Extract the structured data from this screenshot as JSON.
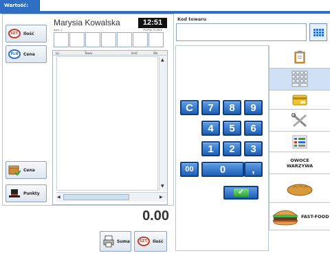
{
  "header": {
    "value_tab": "Wartość: 0.00"
  },
  "left_buttons": [
    {
      "label": "Ilość",
      "icon": "szt-icon",
      "badge": "SZT."
    },
    {
      "label": "Cena",
      "icon": "pln-icon",
      "badge": "PLN"
    },
    {
      "label": "Cena",
      "icon": "box-check-icon"
    },
    {
      "label": "Punkty",
      "icon": "hat-icon"
    }
  ],
  "customer": {
    "name": "Marysia Kowalska",
    "time": "12:51",
    "time_sub": "PO POŁ 71 29.8",
    "small_label": "Zam. 1"
  },
  "table": {
    "columns": [
      "Lp",
      "Towar",
      "Ilość",
      "Wa"
    ]
  },
  "total": "0.00",
  "bottom_buttons": [
    {
      "label": "Suma",
      "icon": "printer-icon"
    },
    {
      "label": "Ilość",
      "icon": "szt-icon",
      "badge": "SZT."
    }
  ],
  "product_code": {
    "label": "Kod towaru",
    "value": ""
  },
  "numpad": {
    "keys": [
      "C",
      "7",
      "8",
      "9",
      "4",
      "5",
      "6",
      "1",
      "2",
      "3",
      "00",
      "0",
      ","
    ],
    "ok_symbol": "✔"
  },
  "categories": [
    {
      "icon": "clipboard-icon"
    },
    {
      "icon": "keypad-icon",
      "active": true
    },
    {
      "icon": "card-icon"
    },
    {
      "icon": "tools-icon"
    },
    {
      "icon": "list-icon"
    },
    {
      "label": "OWOCE WARZYWA"
    },
    {
      "icon": "bread-icon"
    },
    {
      "label": "FAST-FOOD",
      "icon": "burger-icon"
    }
  ],
  "colors": {
    "accent": "#2e6fc4",
    "key": "#1f5fb4",
    "ok": "#2aa33a"
  }
}
